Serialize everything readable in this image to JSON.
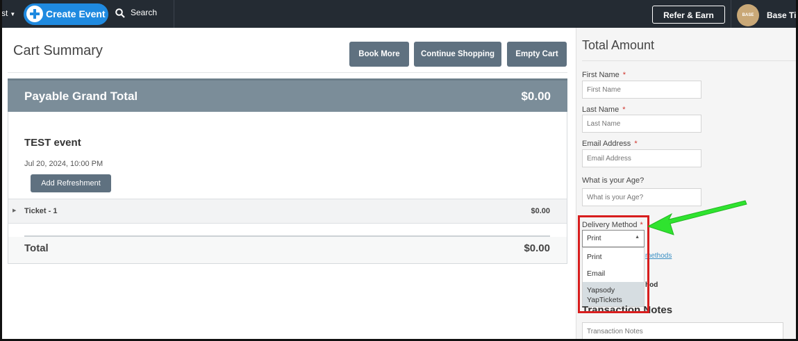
{
  "topbar": {
    "nav_left": "st",
    "create_event": "Create Event",
    "search": "Search",
    "refer_earn": "Refer & Earn",
    "avatar_text": "BASE",
    "user_name": "Base Tie"
  },
  "main": {
    "title": "Cart Summary",
    "buttons": {
      "book_more": "Book More",
      "continue_shopping": "Continue Shopping",
      "empty_cart": "Empty Cart"
    },
    "grand_total_label": "Payable Grand Total",
    "grand_total_value": "$0.00",
    "event": {
      "name": "TEST event",
      "date": "Jul 20, 2024, 10:00 PM",
      "add_refreshment": "Add Refreshment"
    },
    "ticket": {
      "label": "Ticket - 1",
      "value": "$0.00"
    },
    "total": {
      "label": "Total",
      "value": "$0.00"
    }
  },
  "panel": {
    "title": "Total Amount",
    "fields": {
      "first_name": {
        "label": "First Name",
        "placeholder": "First Name",
        "required": "*"
      },
      "last_name": {
        "label": "Last Name",
        "placeholder": "Last Name",
        "required": "*"
      },
      "email": {
        "label": "Email Address",
        "placeholder": "Email Address",
        "required": "*"
      },
      "age": {
        "label": "What is your Age?",
        "placeholder": "What is your Age?"
      }
    },
    "delivery": {
      "label": "Delivery Method",
      "required": "*",
      "selected": "Print",
      "options": [
        "Print",
        "Email",
        "Yapsody YapTickets"
      ]
    },
    "peek_link": "methods",
    "peek_bold": "hod",
    "notes_title": "Transaction Notes",
    "notes_placeholder": "Transaction Notes"
  },
  "colors": {
    "highlight": "#d81e1e",
    "arrow": "#2fe32f",
    "accent": "#1f8ae0"
  }
}
